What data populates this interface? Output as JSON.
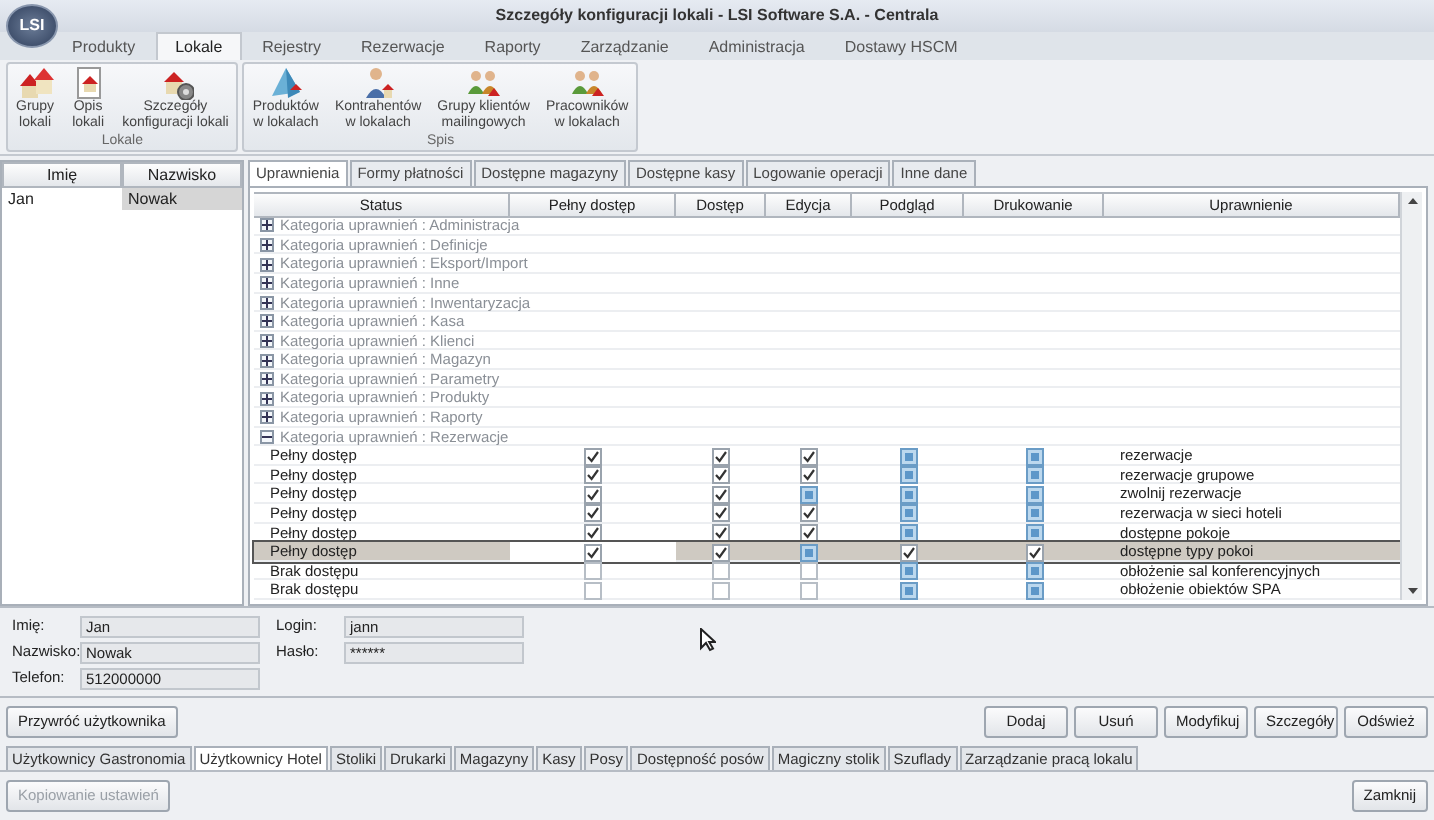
{
  "window": {
    "logo": "LSI",
    "title": "Szczegóły konfiguracji lokali - LSI Software S.A. - Centrala"
  },
  "ribbon": {
    "tabs": [
      {
        "label": "Produkty",
        "selected": false
      },
      {
        "label": "Lokale",
        "selected": true
      },
      {
        "label": "Rejestry",
        "selected": false
      },
      {
        "label": "Rezerwacje",
        "selected": false
      },
      {
        "label": "Raporty",
        "selected": false
      },
      {
        "label": "Zarządzanie",
        "selected": false
      },
      {
        "label": "Administracja",
        "selected": false
      },
      {
        "label": "Dostawy HSCM",
        "selected": false
      }
    ],
    "groups": [
      {
        "title": "Lokale",
        "buttons": [
          {
            "label": "Grupy\nlokali",
            "kind": "houses"
          },
          {
            "label": "Opis\nlokali",
            "kind": "document"
          },
          {
            "label": "Szczegóły\nkonfiguracji lokali",
            "kind": "gear"
          }
        ]
      },
      {
        "title": "Spis",
        "buttons": [
          {
            "label": "Produktów\nw lokalach",
            "kind": "pyramid"
          },
          {
            "label": "Kontrahentów\nw lokalach",
            "kind": "person"
          },
          {
            "label": "Grupy klientów\nmailingowych",
            "kind": "people"
          },
          {
            "label": "Pracowników\nw lokalach",
            "kind": "people"
          }
        ]
      }
    ]
  },
  "users": {
    "columns": [
      "Imię",
      "Nazwisko"
    ],
    "rows": [
      {
        "first": "Jan",
        "last": "Nowak",
        "selected": true
      }
    ]
  },
  "tabs": [
    {
      "label": "Uprawnienia",
      "selected": true
    },
    {
      "label": "Formy płatności",
      "selected": false
    },
    {
      "label": "Dostępne magazyny",
      "selected": false
    },
    {
      "label": "Dostępne kasy",
      "selected": false
    },
    {
      "label": "Logowanie operacji",
      "selected": false
    },
    {
      "label": "Inne dane",
      "selected": false
    }
  ],
  "grid": {
    "columns": [
      "Status",
      "Pełny dostęp",
      "Dostęp",
      "Edycja",
      "Podgląd",
      "Drukowanie",
      "Uprawnienie"
    ],
    "categories": [
      {
        "label": "Kategoria uprawnień : Administracja",
        "expanded": false
      },
      {
        "label": "Kategoria uprawnień : Definicje",
        "expanded": false
      },
      {
        "label": "Kategoria uprawnień : Eksport/Import",
        "expanded": false
      },
      {
        "label": "Kategoria uprawnień : Inne",
        "expanded": false
      },
      {
        "label": "Kategoria uprawnień : Inwentaryzacja",
        "expanded": false
      },
      {
        "label": "Kategoria uprawnień : Kasa",
        "expanded": false
      },
      {
        "label": "Kategoria uprawnień : Klienci",
        "expanded": false
      },
      {
        "label": "Kategoria uprawnień : Magazyn",
        "expanded": false
      },
      {
        "label": "Kategoria uprawnień : Parametry",
        "expanded": false
      },
      {
        "label": "Kategoria uprawnień : Produkty",
        "expanded": false
      },
      {
        "label": "Kategoria uprawnień : Raporty",
        "expanded": false
      },
      {
        "label": "Kategoria uprawnień : Rezerwacje",
        "expanded": true,
        "children": [
          {
            "status": "Pełny dostęp",
            "checks": [
              {
                "checked": true,
                "indeterminate": false
              },
              {
                "checked": true,
                "indeterminate": false
              },
              {
                "checked": true,
                "indeterminate": false
              },
              {
                "checked": false,
                "indeterminate": true
              },
              {
                "checked": false,
                "indeterminate": true
              }
            ],
            "permission": "rezerwacje",
            "selected": false
          },
          {
            "status": "Pełny dostęp",
            "checks": [
              {
                "checked": true,
                "indeterminate": false
              },
              {
                "checked": true,
                "indeterminate": false
              },
              {
                "checked": true,
                "indeterminate": false
              },
              {
                "checked": false,
                "indeterminate": true
              },
              {
                "checked": false,
                "indeterminate": true
              }
            ],
            "permission": "rezerwacje grupowe",
            "selected": false
          },
          {
            "status": "Pełny dostęp",
            "checks": [
              {
                "checked": true,
                "indeterminate": false
              },
              {
                "checked": true,
                "indeterminate": false
              },
              {
                "checked": false,
                "indeterminate": true
              },
              {
                "checked": false,
                "indeterminate": true
              },
              {
                "checked": false,
                "indeterminate": true
              }
            ],
            "permission": "zwolnij rezerwacje",
            "selected": false
          },
          {
            "status": "Pełny dostęp",
            "checks": [
              {
                "checked": true,
                "indeterminate": false
              },
              {
                "checked": true,
                "indeterminate": false
              },
              {
                "checked": true,
                "indeterminate": false
              },
              {
                "checked": false,
                "indeterminate": true
              },
              {
                "checked": false,
                "indeterminate": true
              }
            ],
            "permission": "rezerwacja w sieci hoteli",
            "selected": false
          },
          {
            "status": "Pełny dostęp",
            "checks": [
              {
                "checked": true,
                "indeterminate": false
              },
              {
                "checked": true,
                "indeterminate": false
              },
              {
                "checked": true,
                "indeterminate": false
              },
              {
                "checked": false,
                "indeterminate": true
              },
              {
                "checked": false,
                "indeterminate": true
              }
            ],
            "permission": "dostępne pokoje",
            "selected": false
          },
          {
            "status": "Pełny dostęp",
            "checks": [
              {
                "checked": true,
                "indeterminate": false
              },
              {
                "checked": true,
                "indeterminate": false
              },
              {
                "checked": false,
                "indeterminate": true
              },
              {
                "checked": true,
                "indeterminate": false
              },
              {
                "checked": true,
                "indeterminate": false
              }
            ],
            "permission": "dostępne typy pokoi",
            "selected": true
          },
          {
            "status": "Brak dostępu",
            "checks": [
              {
                "checked": false,
                "indeterminate": false
              },
              {
                "checked": false,
                "indeterminate": false
              },
              {
                "checked": false,
                "indeterminate": false
              },
              {
                "checked": false,
                "indeterminate": true
              },
              {
                "checked": false,
                "indeterminate": true
              }
            ],
            "permission": "obłożenie sal konferencyjnych",
            "selected": false
          },
          {
            "status": "Brak dostępu",
            "checks": [
              {
                "checked": false,
                "indeterminate": false
              },
              {
                "checked": false,
                "indeterminate": false
              },
              {
                "checked": false,
                "indeterminate": false
              },
              {
                "checked": false,
                "indeterminate": true
              },
              {
                "checked": false,
                "indeterminate": true
              }
            ],
            "permission": "obłożenie obiektów SPA",
            "selected": false
          }
        ]
      }
    ]
  },
  "details": {
    "left": [
      {
        "label": "Imię:",
        "value": "Jan"
      },
      {
        "label": "Nazwisko:",
        "value": "Nowak"
      },
      {
        "label": "Telefon:",
        "value": "512000000"
      }
    ],
    "right": [
      {
        "label": "Login:",
        "value": "jann"
      },
      {
        "label": "Hasło:",
        "value": "******"
      }
    ]
  },
  "restore_button": "Przywróć użytkownika",
  "actions": [
    "Dodaj",
    "Usuń",
    "Modyfikuj",
    "Szczegóły",
    "Odśwież"
  ],
  "bottom_tabs": [
    {
      "label": "Użytkownicy Gastronomia",
      "selected": false
    },
    {
      "label": "Użytkownicy Hotel",
      "selected": true
    },
    {
      "label": "Stoliki",
      "selected": false
    },
    {
      "label": "Drukarki",
      "selected": false
    },
    {
      "label": "Magazyny",
      "selected": false
    },
    {
      "label": "Kasy",
      "selected": false
    },
    {
      "label": "Posy",
      "selected": false
    },
    {
      "label": "Dostępność posów",
      "selected": false
    },
    {
      "label": "Magiczny stolik",
      "selected": false
    },
    {
      "label": "Szuflady",
      "selected": false
    },
    {
      "label": "Zarządzanie pracą lokalu",
      "selected": false
    }
  ],
  "footer": {
    "copy_button": {
      "label": "Kopiowanie ustawień",
      "disabled": true
    },
    "close_button": "Zamknij"
  }
}
